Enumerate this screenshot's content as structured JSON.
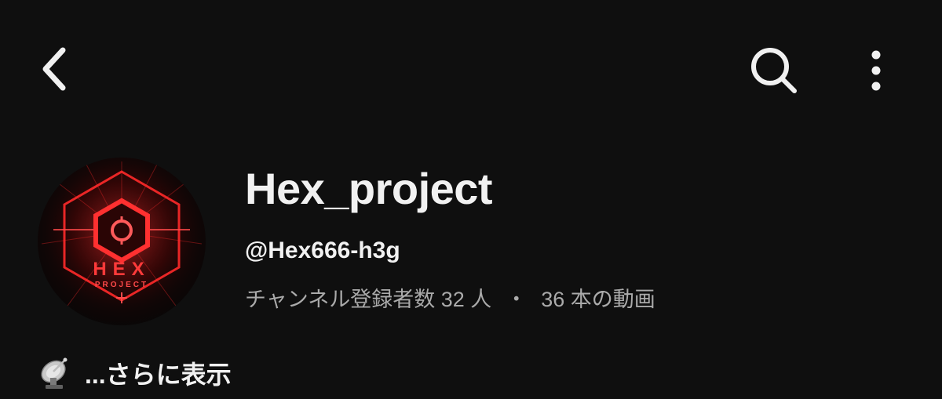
{
  "header": {
    "back_icon": "chevron-left-icon",
    "search_icon": "search-icon",
    "more_icon": "more-vertical-icon"
  },
  "channel": {
    "name": "Hex_project",
    "handle": "@Hex666-h3g",
    "subscribers": "チャンネル登録者数 32 人",
    "separator": "・",
    "videos": "36 本の動画",
    "avatar_logo_text": "HEX",
    "avatar_logo_subtext": "PROJECT"
  },
  "description": {
    "emoji_icon": "satellite-dish-icon",
    "more_label": "...さらに表示"
  },
  "colors": {
    "background": "#0f0f0f",
    "primary_text": "#f1f1f1",
    "secondary_text": "#aaaaaa",
    "avatar_accent": "#ff2a2a"
  }
}
